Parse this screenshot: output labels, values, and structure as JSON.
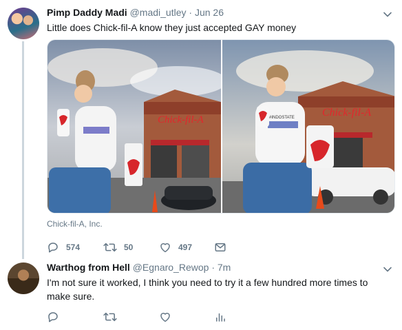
{
  "tweets": [
    {
      "name": "Pimp Daddy Madi",
      "handle": "@madi_utley",
      "separator": "·",
      "time": "Jun 26",
      "text": "Little does Chick-fil-A know they just accepted GAY money",
      "source": "Chick-fil-A, Inc.",
      "replies": "574",
      "retweets": "50",
      "likes": "497",
      "media": {
        "sign_text": "Chick-fil-A",
        "shirt_text": "#INDOSTATE"
      }
    },
    {
      "name": "Warthog from Hell",
      "handle": "@Egnaro_Rewop",
      "separator": "·",
      "time": "7m",
      "text_line1": "I'm not sure it worked, I think you need to try it a few hundred more times to",
      "text_line2": "make sure."
    }
  ],
  "colors": {
    "text": "#14171a",
    "secondary": "#657786",
    "thread_line": "#ccd6dd",
    "brand_red": "#dd0033"
  },
  "icons": [
    "chevron-down-icon",
    "reply-icon",
    "retweet-icon",
    "like-icon",
    "dm-icon",
    "analytics-icon"
  ]
}
